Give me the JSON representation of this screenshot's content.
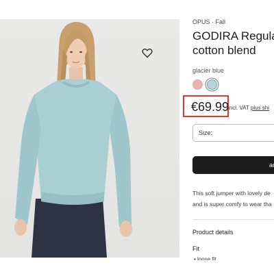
{
  "product": {
    "brand": "OPUS · Fall",
    "title_line1": "GODIRA Regular",
    "title_line2": "cotton blend",
    "color_name": "glacier blue",
    "swatches": [
      {
        "name": "pink",
        "hex": "#e8b3b3"
      },
      {
        "name": "glacier blue",
        "hex": "#b9d6dc"
      }
    ],
    "price": "€69.99",
    "vat_text": "incl. VAT",
    "shipping_link": "plus shi",
    "size_label": "Size:",
    "add_button_label": "ad",
    "description_line1": "This soft jumper with lovely de",
    "description_line2": "and is super comfy to wear tha",
    "details_heading": "Product details",
    "fit_heading": "Fit",
    "fit_item": "• loose fit"
  },
  "colors": {
    "highlight": "#e4382c",
    "button": "#1c1c1c",
    "sweater": "#a9cfd2",
    "photo_bg": "#e7e7e5"
  },
  "icons": {
    "wishlist": "heart-outline-icon",
    "size_dropdown": "chevron-down-icon"
  }
}
